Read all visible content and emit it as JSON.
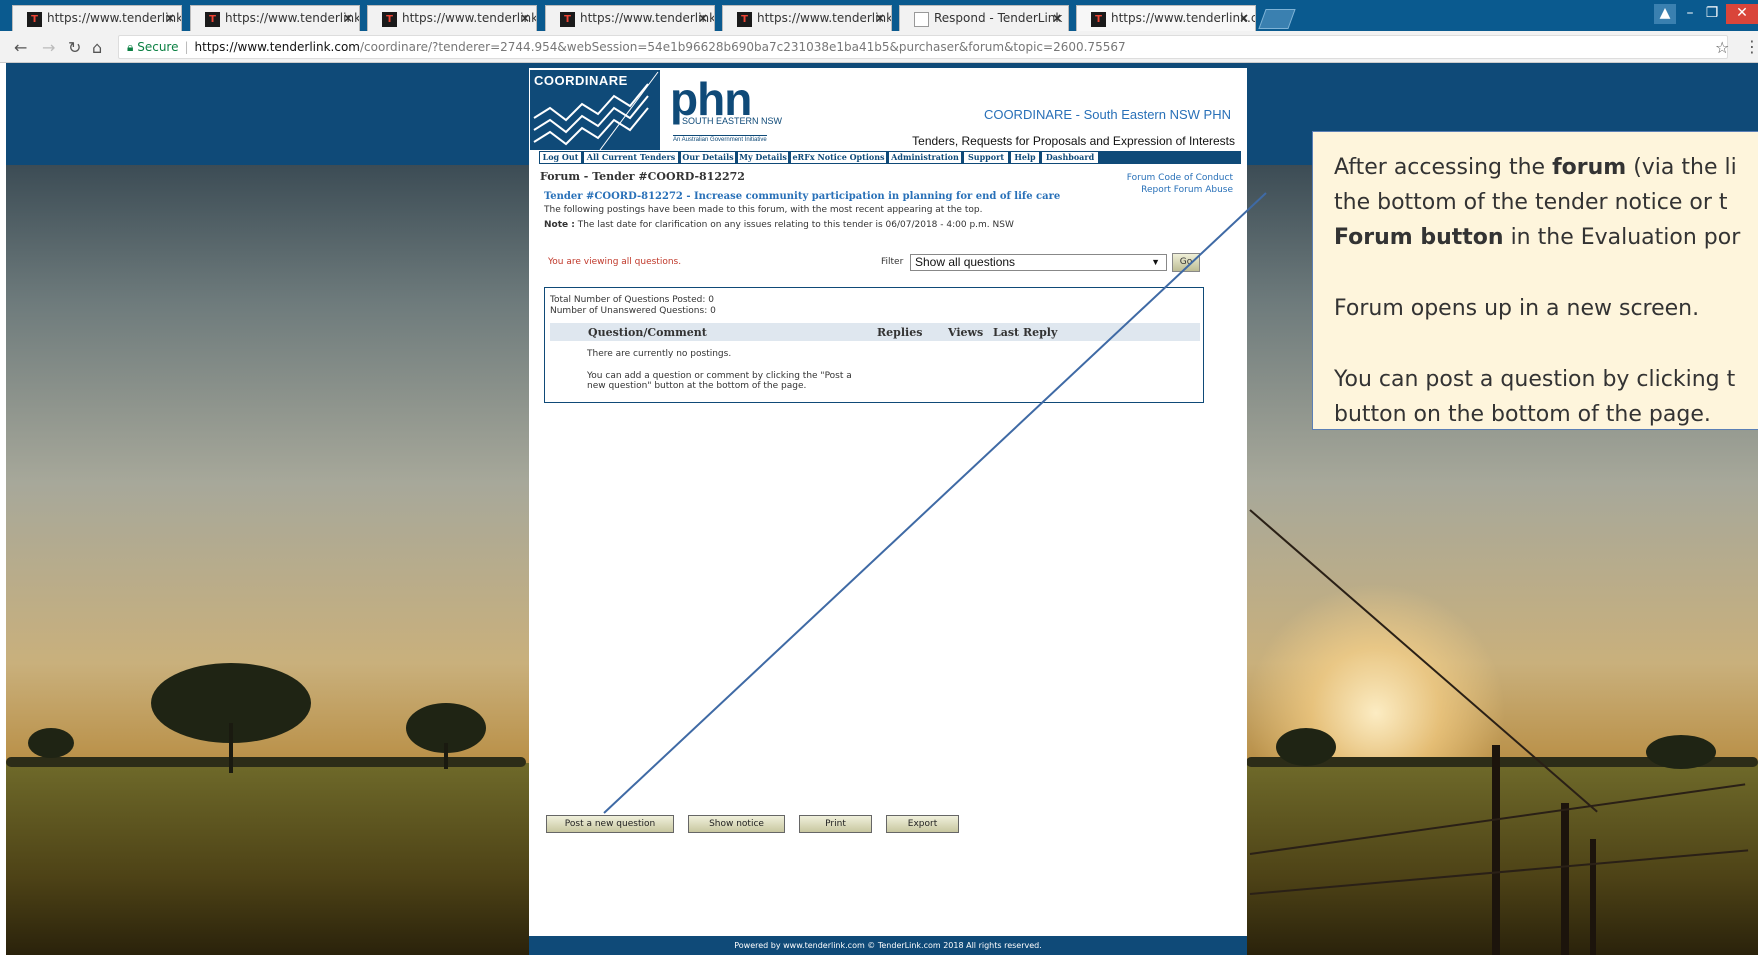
{
  "browser": {
    "tabs": [
      {
        "title": "https://www.tenderlink.co",
        "favicon": "tenderlink-icon",
        "active": false
      },
      {
        "title": "https://www.tenderlink.co",
        "favicon": "tenderlink-icon",
        "active": false
      },
      {
        "title": "https://www.tenderlink.co",
        "favicon": "tenderlink-icon",
        "active": false
      },
      {
        "title": "https://www.tenderlink.co",
        "favicon": "tenderlink-icon",
        "active": false
      },
      {
        "title": "https://www.tenderlink.co",
        "favicon": "tenderlink-icon",
        "active": false
      },
      {
        "title": "Respond - TenderLink",
        "favicon": "document-icon",
        "active": false
      },
      {
        "title": "https://www.tenderlink.co",
        "favicon": "tenderlink-icon",
        "active": true
      }
    ],
    "secure_label": "Secure",
    "url_host": "https://www.tenderlink.com",
    "url_path": "/coordinare/?tenderer=2744.954&webSession=54e1b96628b690ba7c231038e1ba41b5&purchaser&forum&topic=2600.75567",
    "tab_close_glyph": "×"
  },
  "site": {
    "logo_word": "COORDINARE",
    "phn": "phn",
    "phn_sub": "SOUTH EASTERN NSW",
    "phn_gov": "An Australian Government Initiative",
    "org_name": "COORDINARE - South Eastern NSW PHN",
    "tagline": "Tenders, Requests for Proposals and Expression of Interests",
    "brand_color": "#0f4a78",
    "link_color": "#2870b8"
  },
  "nav": [
    "Log Out",
    "All Current Tenders",
    "Our Details",
    "My Details",
    "eRFx Notice Options",
    "Administration",
    "Support",
    "Help",
    "Dashboard"
  ],
  "forum": {
    "title": "Forum - Tender #COORD-812272",
    "code_of_conduct": "Forum Code of Conduct",
    "report_abuse": "Report Forum Abuse",
    "tender_line": "Tender #COORD-812272 - Increase community participation in planning for end of life care",
    "intro": "The following postings have been made to this forum, with the most recent appearing at the top.",
    "note_label": "Note :",
    "note": "The last date for clarification on any issues relating to this tender is 06/07/2018 - 4:00 p.m. NSW",
    "viewing": "You are viewing all questions.",
    "filter_label": "Filter",
    "filter_value": "Show all questions",
    "go_label": "Go",
    "total_posted": "Total Number of Questions Posted: 0",
    "unanswered": "Number of Unanswered Questions: 0",
    "columns": [
      "Question/Comment",
      "Replies",
      "Views",
      "Last Reply"
    ],
    "no_postings": "There are currently no postings.",
    "hint_line1": "You can add a question or comment by clicking the \"Post a",
    "hint_line2": "new question\" button at the bottom of the page.",
    "buttons": [
      "Post a new question",
      "Show notice",
      "Print",
      "Export"
    ],
    "footer": "Powered by www.tenderlink.com     © TenderLink.com 2018 All rights reserved."
  },
  "callout": {
    "p1_a": "After accessing the ",
    "p1_b": "forum",
    "p1_c": " (via the li",
    "p1_line2": "the bottom of the tender notice or t",
    "p1_line3_b": "Forum button",
    "p1_line3_c": " in the Evaluation por",
    "p2": "Forum opens up in a new screen.",
    "p3_line1": "You can post a question by clicking t",
    "p3_line2": "button on the bottom of the page."
  }
}
